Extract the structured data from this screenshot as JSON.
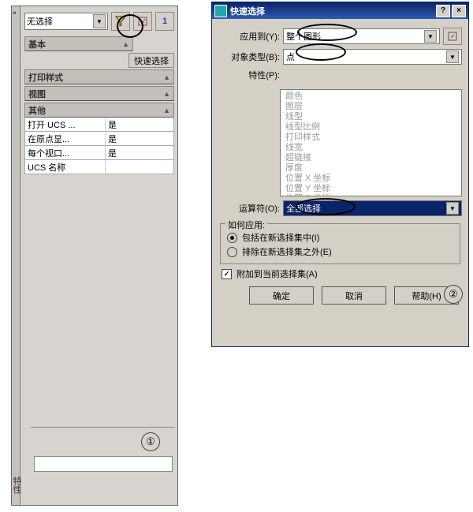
{
  "left_panel": {
    "selection_combo": "无选择",
    "quick_select_btn": "快速选择",
    "sections": {
      "basic": "基本",
      "print_style": "打印样式",
      "view": "视图",
      "other": "其他"
    },
    "other_rows": [
      {
        "k": "打开 UCS ...",
        "v": "是"
      },
      {
        "k": "在原点显...",
        "v": "是"
      },
      {
        "k": "每个视口...",
        "v": "是"
      },
      {
        "k": "UCS 名称",
        "v": ""
      }
    ],
    "badge": "①",
    "v_label": "特性"
  },
  "dialog": {
    "title": "快速选择",
    "labels": {
      "apply_to": "应用到(Y):",
      "obj_type": "对象类型(B):",
      "properties": "特性(P):",
      "operator": "运算符(O):",
      "how_apply": "如何应用:",
      "radio_include": "包括在新选择集中(I)",
      "radio_exclude": "排除在新选择集之外(E)",
      "append_chk": "附加到当前选择集(A)"
    },
    "values": {
      "apply_to": "整个图形",
      "obj_type": "点",
      "operator": "全部选择"
    },
    "props_list": [
      "颜色",
      "图层",
      "线型",
      "线型比例",
      "打印样式",
      "线宽",
      "超链接",
      "厚度",
      "位置 X 坐标",
      "位置 Y 坐标",
      "位置 Z 坐标"
    ],
    "buttons": {
      "ok": "确定",
      "cancel": "取消",
      "help": "帮助(H)"
    },
    "badge": "②",
    "close": "×",
    "help_q": "?"
  }
}
